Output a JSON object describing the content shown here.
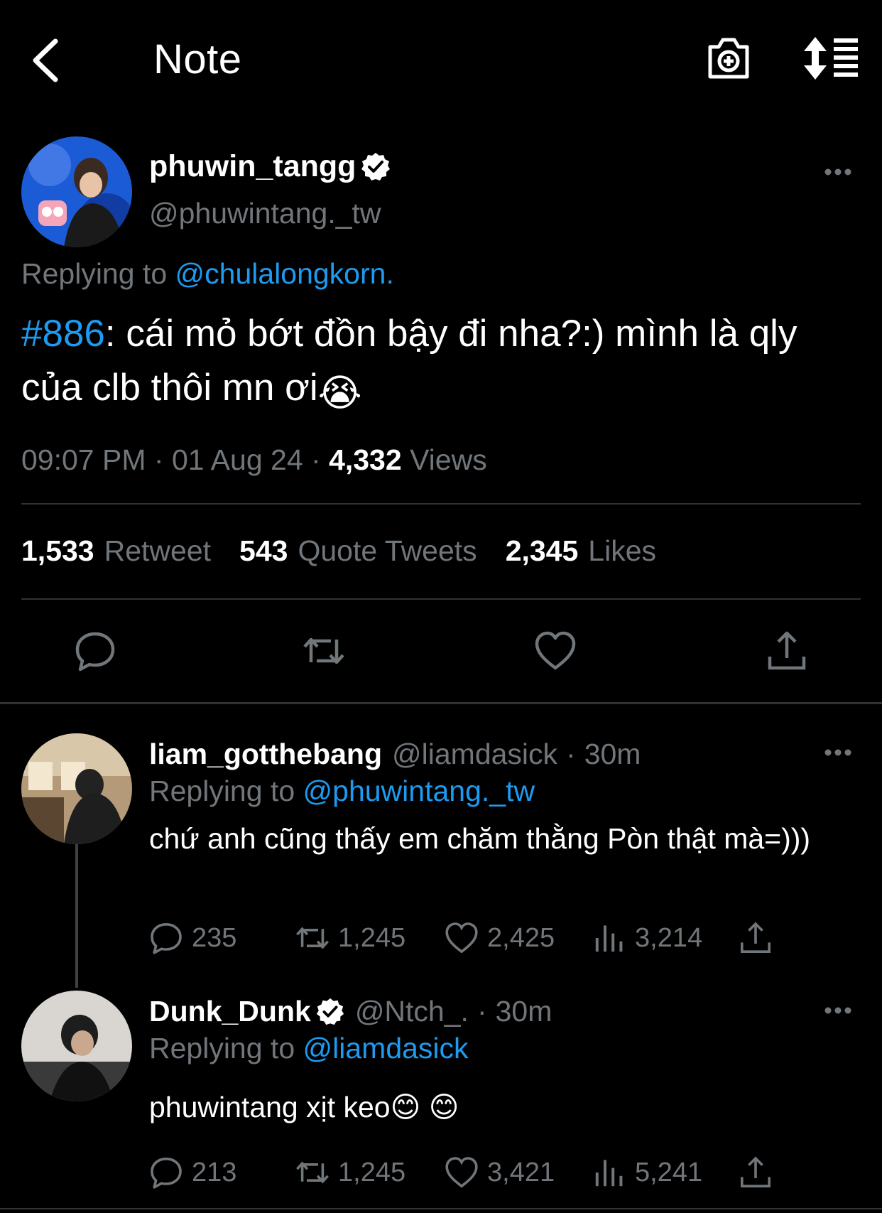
{
  "header": {
    "title": "Note"
  },
  "tweet": {
    "display_name": "phuwin_tangg",
    "handle": "@phuwintang._tw",
    "replying_prefix": "Replying to",
    "replying_to": "@chulalongkorn.",
    "hashtag": "#886",
    "text_rest": ": cái mỏ bớt đồn bậy đi nha?:) mình là qly của clb thôi mn ơi",
    "emoji": "😭",
    "time": "09:07 PM",
    "date": "01 Aug 24",
    "views_count": "4,332",
    "views_label": "Views",
    "retweets_count": "1,533",
    "retweets_label": "Retweet",
    "quotes_count": "543",
    "quotes_label": "Quote Tweets",
    "likes_count": "2,345",
    "likes_label": "Likes"
  },
  "replies": [
    {
      "display_name": "liam_gotthebang",
      "handle": "@liamdasick",
      "time": "30m",
      "replying_prefix": "Replying to",
      "replying_to": "@phuwintang._tw",
      "text": "chứ anh cũng thấy em chăm thằng Pòn thật mà=)))",
      "replies": "235",
      "retweets": "1,245",
      "likes": "2,425",
      "views": "3,214"
    },
    {
      "display_name": "Dunk_Dunk",
      "handle": "@Ntch_.",
      "time": "30m",
      "replying_prefix": "Replying to",
      "replying_to": "@liamdasick",
      "text": "phuwintang xịt keo",
      "emoji": "😊 😊",
      "replies": "213",
      "retweets": "1,245",
      "likes": "3,421",
      "views": "5,241"
    }
  ],
  "colors": {
    "link": "#1d9bf0",
    "muted": "#71767b",
    "background": "#000000",
    "divider": "#2f3336"
  }
}
